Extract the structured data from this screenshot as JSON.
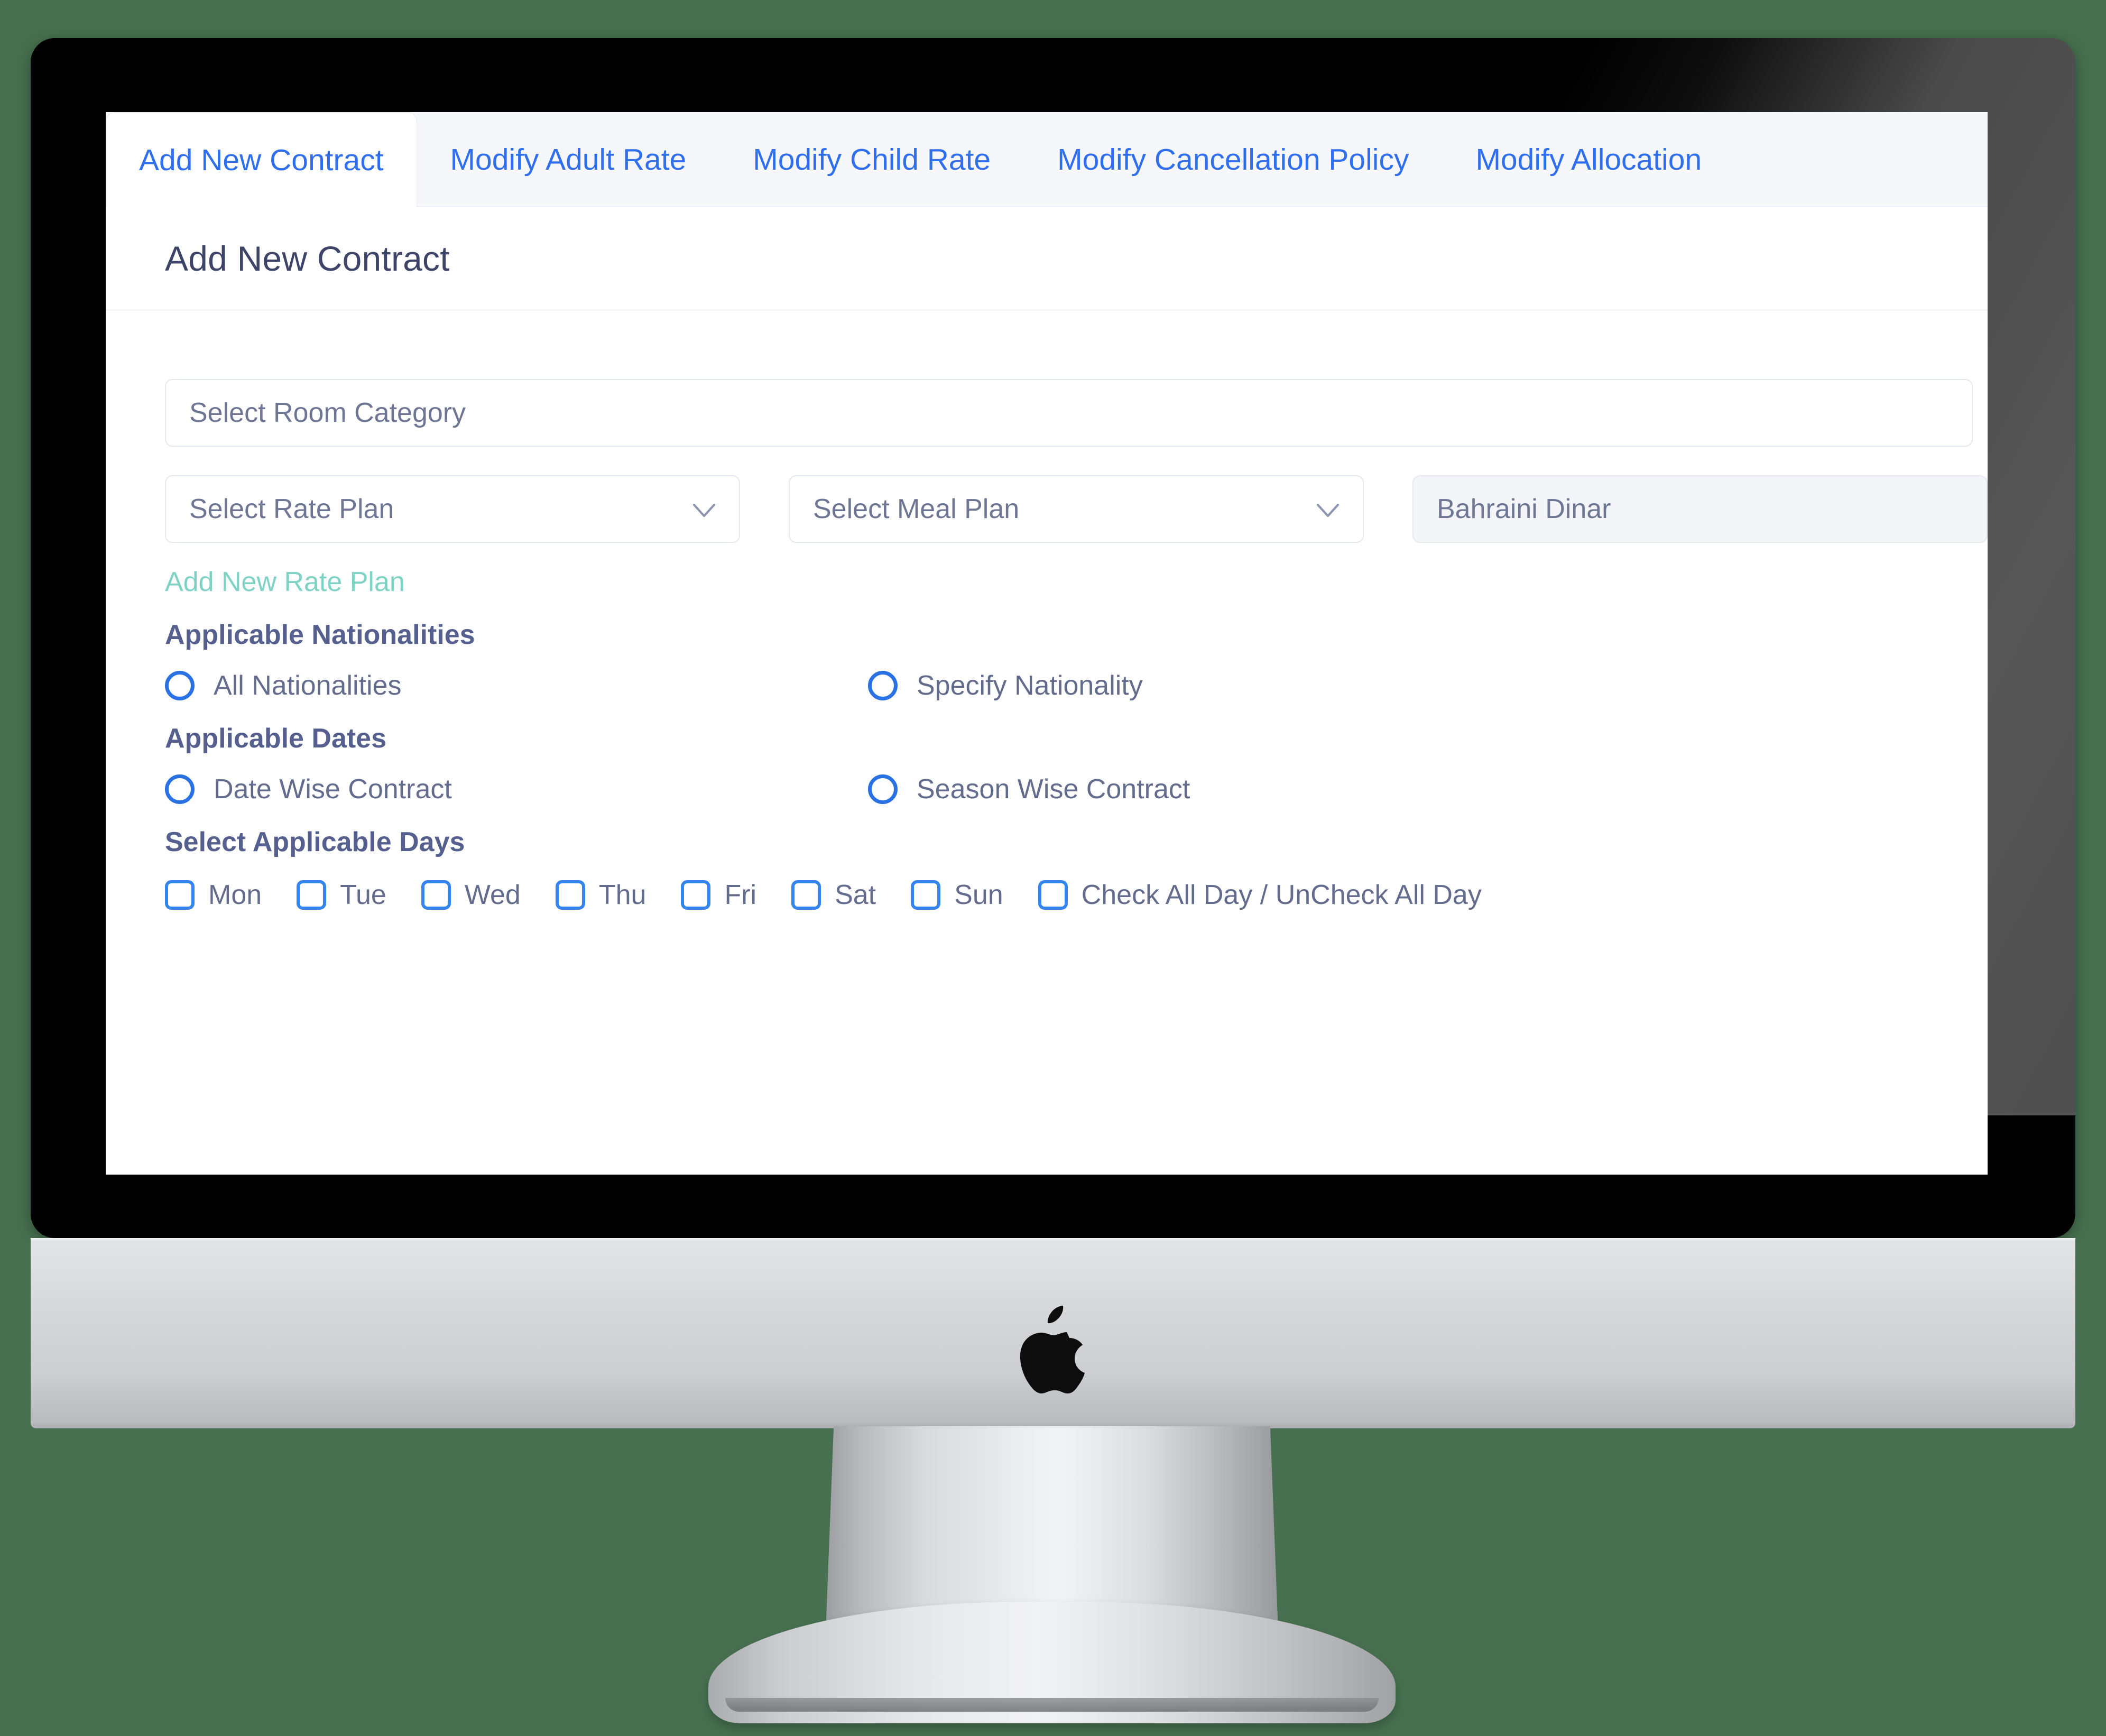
{
  "tabs": [
    {
      "label": "Add New Contract",
      "active": true
    },
    {
      "label": "Modify Adult Rate",
      "active": false
    },
    {
      "label": "Modify Child Rate",
      "active": false
    },
    {
      "label": "Modify Cancellation Policy",
      "active": false
    },
    {
      "label": "Modify Allocation",
      "active": false
    }
  ],
  "page": {
    "title": "Add New Contract"
  },
  "form": {
    "room_category": {
      "placeholder": "Select Room Category",
      "value": "Select Room Category"
    },
    "rate_plan": {
      "placeholder": "Select Rate Plan",
      "value": "Select Rate Plan"
    },
    "meal_plan": {
      "placeholder": "Select Meal Plan",
      "value": "Select Meal Plan"
    },
    "currency": {
      "value": "Bahraini Dinar"
    },
    "add_rate_plan_link": "Add New Rate Plan"
  },
  "nationalities": {
    "heading": "Applicable Nationalities",
    "options": [
      {
        "label": "All Nationalities",
        "selected": false
      },
      {
        "label": "Specify Nationality",
        "selected": false
      }
    ]
  },
  "dates": {
    "heading": "Applicable Dates",
    "options": [
      {
        "label": "Date Wise Contract",
        "selected": false
      },
      {
        "label": "Season Wise Contract",
        "selected": false
      }
    ]
  },
  "days": {
    "heading": "Select Applicable Days",
    "items": [
      {
        "label": "Mon",
        "checked": false
      },
      {
        "label": "Tue",
        "checked": false
      },
      {
        "label": "Wed",
        "checked": false
      },
      {
        "label": "Thu",
        "checked": false
      },
      {
        "label": "Fri",
        "checked": false
      },
      {
        "label": "Sat",
        "checked": false
      },
      {
        "label": "Sun",
        "checked": false
      },
      {
        "label": "Check All Day / UnCheck All Day",
        "checked": false
      }
    ]
  },
  "device": {
    "brand_logo": "apple-logo"
  },
  "colors": {
    "background": "#477050",
    "tab_link": "#2f6fed",
    "heading": "#56608f",
    "label": "#646c8e",
    "accent_link": "#7fd3c4",
    "control_blue": "#2a72e3",
    "checkbox_blue": "#3585ee",
    "field_border": "#e6e8f0",
    "readonly_bg": "#f4f5f8"
  }
}
